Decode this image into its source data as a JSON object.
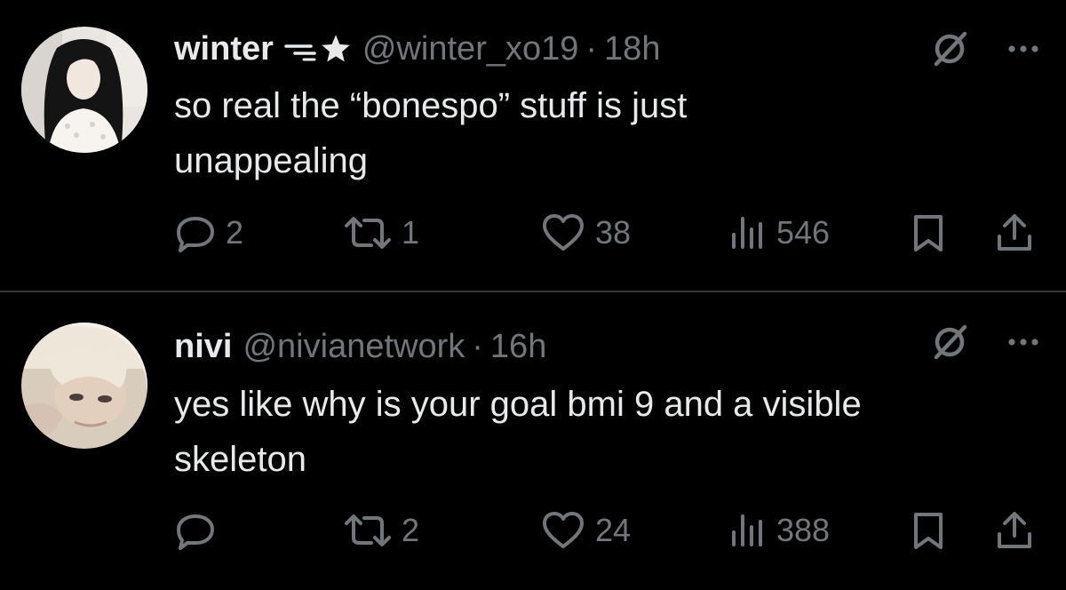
{
  "colors": {
    "background": "#000000",
    "text_primary": "#e7e9ea",
    "text_secondary": "#71767b",
    "divider": "#2f3336"
  },
  "tweets": [
    {
      "display_name": "winter",
      "badge_icons": [
        "double-dash-icon",
        "star-icon"
      ],
      "handle": "@winter_xo19",
      "separator": "·",
      "time": "18h",
      "text": "so real the “bonespo” stuff is just\nunappealing",
      "counts": {
        "replies": "2",
        "retweets": "1",
        "likes": "38",
        "views": "546"
      },
      "avatar_icon": "user-avatar-photo"
    },
    {
      "display_name": "nivi",
      "badge_icons": [],
      "handle": "@nivianetwork",
      "separator": "·",
      "time": "16h",
      "text": "yes like why is your goal bmi 9 and a visible\nskeleton",
      "counts": {
        "replies": "",
        "retweets": "2",
        "likes": "24",
        "views": "388"
      },
      "avatar_icon": "user-avatar-photo"
    }
  ],
  "icons": {
    "top": [
      "grok-icon",
      "more-icon"
    ],
    "actions": [
      "reply-icon",
      "retweet-icon",
      "like-icon",
      "views-icon",
      "bookmark-icon",
      "share-icon"
    ]
  }
}
